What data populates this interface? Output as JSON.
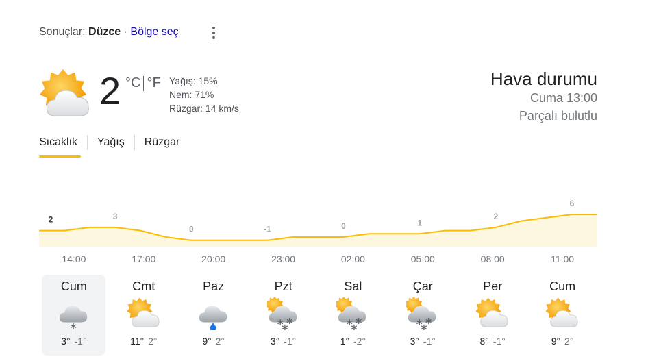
{
  "location": {
    "prefix": "Sonuçlar:",
    "city": "Düzce",
    "separator": "·",
    "change_link": "Bölge seç"
  },
  "current": {
    "temperature": "2",
    "unit_c": "°C",
    "unit_f": "°F",
    "precip": "Yağış: 15%",
    "humidity": "Nem: 71%",
    "wind": "Rüzgar: 14 km/s",
    "icon": "partly-cloudy-icon"
  },
  "header": {
    "title": "Hava durumu",
    "time": "Cuma 13:00",
    "condition": "Parçalı bulutlu"
  },
  "tabs": [
    {
      "label": "Sıcaklık",
      "active": true
    },
    {
      "label": "Yağış",
      "active": false
    },
    {
      "label": "Rüzgar",
      "active": false
    }
  ],
  "chart_data": {
    "type": "area",
    "x": [
      "14:00",
      "15:00",
      "16:00",
      "17:00",
      "18:00",
      "19:00",
      "20:00",
      "21:00",
      "22:00",
      "23:00",
      "00:00",
      "01:00",
      "02:00",
      "03:00",
      "04:00",
      "05:00",
      "06:00",
      "07:00",
      "08:00",
      "09:00",
      "10:00",
      "11:00",
      "12:00"
    ],
    "values": [
      2,
      2,
      3,
      3,
      2,
      0,
      -1,
      -1,
      -1,
      -1,
      0,
      0,
      0,
      1,
      1,
      1,
      2,
      2,
      3,
      5,
      6,
      7,
      7
    ],
    "labels": [
      {
        "x": "14:00",
        "text": "2"
      },
      {
        "x": "17:00",
        "text": "3"
      },
      {
        "x": "20:00",
        "text": "0"
      },
      {
        "x": "23:00",
        "text": "-1"
      },
      {
        "x": "02:00",
        "text": "0"
      },
      {
        "x": "05:00",
        "text": "1"
      },
      {
        "x": "08:00",
        "text": "2"
      },
      {
        "x": "11:00",
        "text": "6"
      }
    ],
    "tick_labels": [
      "14:00",
      "17:00",
      "20:00",
      "23:00",
      "02:00",
      "05:00",
      "08:00",
      "11:00"
    ],
    "line_color": "#fbbc04",
    "fill_color": "#fef7e0"
  },
  "forecast": [
    {
      "day": "Cum",
      "icon": "cloud-snow-icon",
      "high": "3°",
      "low": "-1°",
      "selected": true
    },
    {
      "day": "Cmt",
      "icon": "partly-cloudy-icon",
      "high": "11°",
      "low": "2°",
      "selected": false
    },
    {
      "day": "Paz",
      "icon": "cloud-rain-icon",
      "high": "9°",
      "low": "2°",
      "selected": false
    },
    {
      "day": "Pzt",
      "icon": "partly-cloudy-snow-icon",
      "high": "3°",
      "low": "-1°",
      "selected": false
    },
    {
      "day": "Sal",
      "icon": "partly-cloudy-snow-icon",
      "high": "1°",
      "low": "-2°",
      "selected": false
    },
    {
      "day": "Çar",
      "icon": "partly-cloudy-snow-icon",
      "high": "3°",
      "low": "-1°",
      "selected": false
    },
    {
      "day": "Per",
      "icon": "partly-cloudy-icon",
      "high": "8°",
      "low": "-1°",
      "selected": false
    },
    {
      "day": "Cum",
      "icon": "partly-cloudy-icon",
      "high": "9°",
      "low": "2°",
      "selected": false
    }
  ]
}
